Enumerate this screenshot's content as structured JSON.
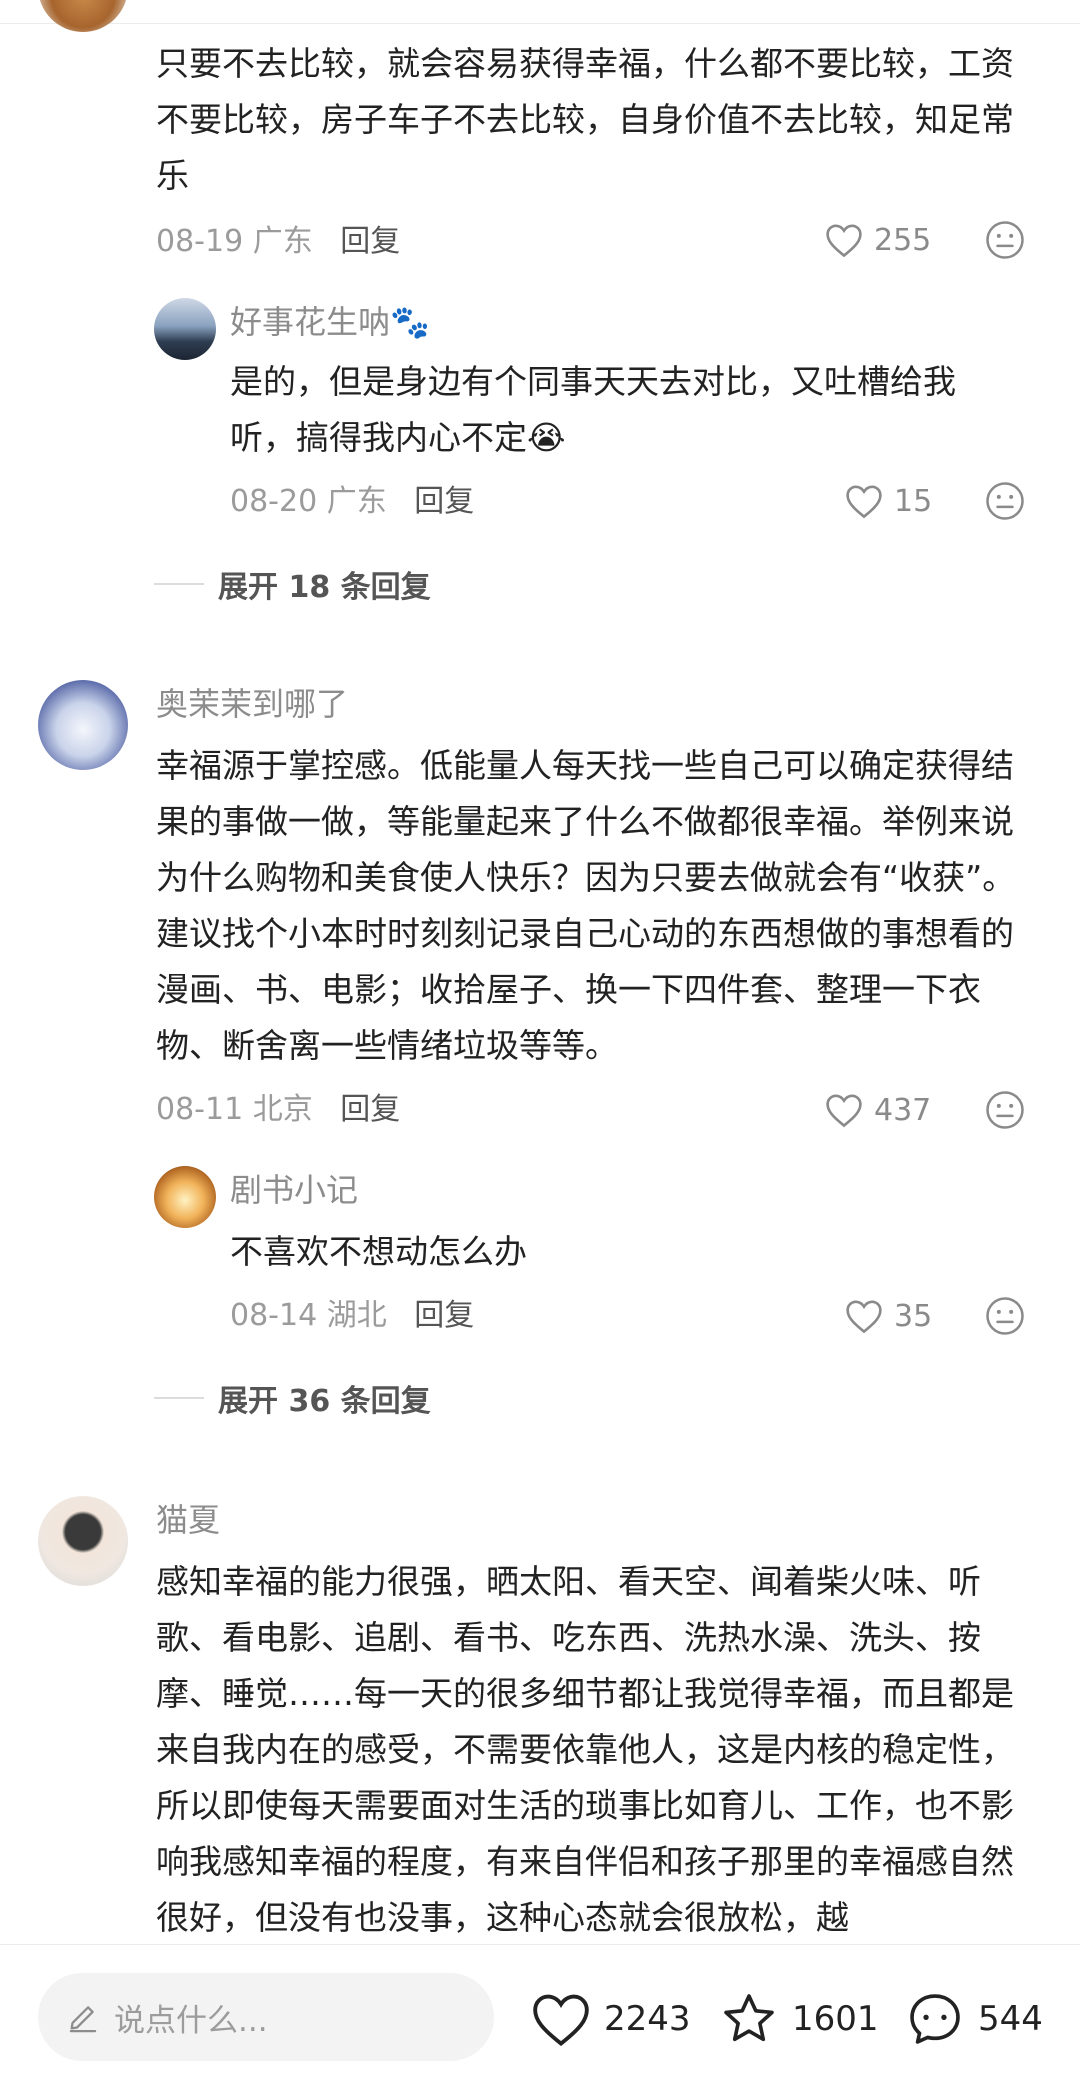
{
  "comments": [
    {
      "text": "只要不去比较，就会容易获得幸福，什么都不要比较，工资不要比较，房子车子不去比较，自身价值不去比较，知足常乐",
      "date": "08-19",
      "location": "广东",
      "reply_label": "回复",
      "likes": "255",
      "replies": [
        {
          "user": "好事花生呐🐾",
          "text": "是的，但是身边有个同事天天去对比，又吐槽给我听，搞得我内心不定😭",
          "date": "08-20",
          "location": "广东",
          "reply_label": "回复",
          "likes": "15"
        }
      ],
      "expand_label": "展开 18 条回复"
    },
    {
      "user": "奥茉茉到哪了",
      "text": "幸福源于掌控感。低能量人每天找一些自己可以确定获得结果的事做一做，等能量起来了什么不做都很幸福。举例来说为什么购物和美食使人快乐？因为只要去做就会有“收获”。建议找个小本时时刻刻记录自己心动的东西想做的事想看的漫画、书、电影；收拾屋子、换一下四件套、整理一下衣物、断舍离一些情绪垃圾等等。",
      "date": "08-11",
      "location": "北京",
      "reply_label": "回复",
      "likes": "437",
      "replies": [
        {
          "user": "剧书小记",
          "text": "不喜欢不想动怎么办",
          "date": "08-14",
          "location": "湖北",
          "reply_label": "回复",
          "likes": "35"
        }
      ],
      "expand_label": "展开 36 条回复"
    },
    {
      "user": "猫夏",
      "text": "感知幸福的能力很强，晒太阳、看天空、闻着柴火味、听歌、看电影、追剧、看书、吃东西、洗热水澡、洗头、按摩、睡觉……每一天的很多细节都让我觉得幸福，而且都是来自我内在的感受，不需要依靠他人，这是内核的稳定性，所以即使每天需要面对生活的琐事比如育儿、工作，也不影响我感知幸福的程度，有来自伴侣和孩子那里的幸福感自然很好，但没有也没事，这种心态就会很放松，越"
    }
  ],
  "bottom_bar": {
    "input_placeholder": "说点什么...",
    "likes": "2243",
    "favorites": "1601",
    "comments": "544"
  },
  "icons": {
    "like": "heart-icon",
    "dislike": "neutral-face-icon",
    "favorite": "star-icon",
    "comment": "speech-bubble-icon",
    "edit": "pencil-icon"
  }
}
